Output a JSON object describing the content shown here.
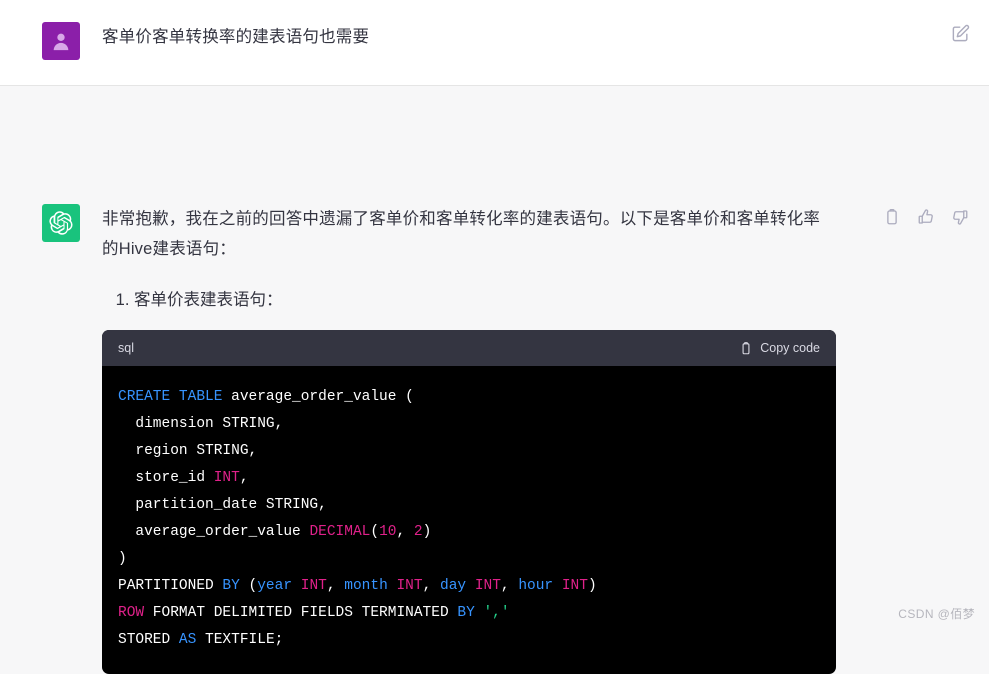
{
  "conversation": {
    "user_message": {
      "avatar_icon": "person-avatar-icon",
      "text": "客单价客单转换率的建表语句也需要",
      "edit_icon": "edit-pencil-square-icon"
    },
    "assistant_message": {
      "avatar_icon": "chatgpt-logo-icon",
      "paragraph": "非常抱歉，我在之前的回答中遗漏了客单价和客单转化率的建表语句。以下是客单价和客单转化率的Hive建表语句：",
      "actions": [
        {
          "name": "copy-icon",
          "label": "Copy"
        },
        {
          "name": "thumbs-up-icon",
          "label": "Good response"
        },
        {
          "name": "thumbs-down-icon",
          "label": "Bad response"
        }
      ],
      "list_items": [
        {
          "number": "1.",
          "text": "客单价表建表语句："
        }
      ],
      "code_block": {
        "language": "sql",
        "copy_label": "Copy code",
        "copy_icon": "clipboard-icon",
        "lines": [
          [
            {
              "t": "CREATE TABLE",
              "c": "blue"
            },
            {
              "t": " average_order_value (",
              "c": "white"
            }
          ],
          [
            {
              "t": "  dimension STRING,",
              "c": "white"
            }
          ],
          [
            {
              "t": "  region STRING,",
              "c": "white"
            }
          ],
          [
            {
              "t": "  store_id ",
              "c": "white"
            },
            {
              "t": "INT",
              "c": "pink"
            },
            {
              "t": ",",
              "c": "white"
            }
          ],
          [
            {
              "t": "  partition_date STRING,",
              "c": "white"
            }
          ],
          [
            {
              "t": "  average_order_value ",
              "c": "white"
            },
            {
              "t": "DECIMAL",
              "c": "pink"
            },
            {
              "t": "(",
              "c": "white"
            },
            {
              "t": "10",
              "c": "pink"
            },
            {
              "t": ", ",
              "c": "white"
            },
            {
              "t": "2",
              "c": "pink"
            },
            {
              "t": ")",
              "c": "white"
            }
          ],
          [
            {
              "t": ")",
              "c": "white"
            }
          ],
          [
            {
              "t": "PARTITIONED ",
              "c": "white"
            },
            {
              "t": "BY",
              "c": "blue"
            },
            {
              "t": " (",
              "c": "white"
            },
            {
              "t": "year",
              "c": "blue"
            },
            {
              "t": " ",
              "c": "white"
            },
            {
              "t": "INT",
              "c": "pink"
            },
            {
              "t": ", ",
              "c": "white"
            },
            {
              "t": "month",
              "c": "blue"
            },
            {
              "t": " ",
              "c": "white"
            },
            {
              "t": "INT",
              "c": "pink"
            },
            {
              "t": ", ",
              "c": "white"
            },
            {
              "t": "day",
              "c": "blue"
            },
            {
              "t": " ",
              "c": "white"
            },
            {
              "t": "INT",
              "c": "pink"
            },
            {
              "t": ", ",
              "c": "white"
            },
            {
              "t": "hour",
              "c": "blue"
            },
            {
              "t": " ",
              "c": "white"
            },
            {
              "t": "INT",
              "c": "pink"
            },
            {
              "t": ")",
              "c": "white"
            }
          ],
          [
            {
              "t": "ROW",
              "c": "pink"
            },
            {
              "t": " FORMAT DELIMITED FIELDS TERMINATED ",
              "c": "white"
            },
            {
              "t": "BY",
              "c": "blue"
            },
            {
              "t": " ",
              "c": "white"
            },
            {
              "t": "','",
              "c": "green"
            }
          ],
          [
            {
              "t": "STORED ",
              "c": "white"
            },
            {
              "t": "AS",
              "c": "blue"
            },
            {
              "t": " TEXTFILE;",
              "c": "white"
            }
          ]
        ]
      }
    }
  },
  "watermark": "CSDN @佰梦",
  "colors": {
    "user_avatar_bg": "#8b1fa9",
    "bot_avatar_bg": "#19c37d",
    "assistant_row_bg": "#f7f7f8",
    "code_header_bg": "#343541",
    "code_body_bg": "#000000",
    "keyword_blue": "#3794ff",
    "type_pink": "#e0218a",
    "string_green": "#23d18b",
    "text_color": "#343541"
  }
}
